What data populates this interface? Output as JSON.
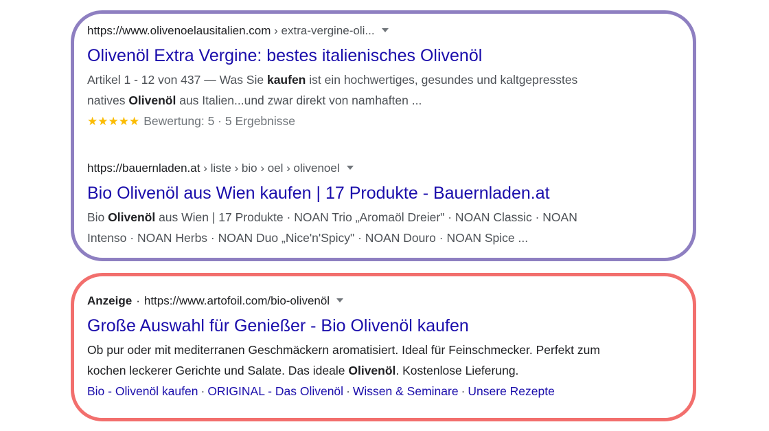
{
  "results": [
    {
      "url_domain": "https://www.olivenoelausitalien.com",
      "url_path": " › extra-vergine-oli...",
      "title": "Olivenöl Extra Vergine: bestes italienisches Olivenöl",
      "snippet_line1": [
        "Artikel 1 - 12 von 437 — Was Sie ",
        "kaufen",
        " ist ein hochwertiges, gesundes und kaltgepresstes"
      ],
      "snippet_line2": [
        "natives ",
        "Olivenöl",
        " aus Italien...und zwar direkt von namhaften ..."
      ],
      "stars": "★★★★★",
      "rating_text": "Bewertung: 5 · 5 Ergebnisse",
      "rating_value": 5
    },
    {
      "url_domain": "https://bauernladen.at",
      "url_path": " › liste › bio › oel › olivenoel",
      "title": "Bio Olivenöl aus Wien kaufen | 17 Produkte - Bauernladen.at",
      "snippet_line1": [
        "Bio ",
        "Olivenöl",
        " aus Wien | 17 Produkte · NOAN Trio „Aromaöl Dreier\" · NOAN Classic · NOAN"
      ],
      "snippet_line2": [
        "Intenso · NOAN Herbs · NOAN Duo „Nice'n'Spicy\" · NOAN Douro · NOAN Spice ..."
      ]
    }
  ],
  "ad": {
    "label": "Anzeige",
    "dot": "·",
    "url": "https://www.artofoil.com/bio-olivenöl",
    "title": "Große Auswahl für Genießer - Bio Olivenöl kaufen",
    "snippet_line1": [
      "Ob pur oder mit mediterranen Geschmäckern aromatisiert. Ideal für Feinschmecker. Perfekt zum"
    ],
    "snippet_line2": [
      "kochen leckerer Gerichte und Salate. Das ideale ",
      "Olivenöl",
      ". Kostenlose Lieferung."
    ],
    "sitelinks": [
      "Bio - Olivenöl kaufen",
      "ORIGINAL - Das Olivenöl",
      "Wissen & Seminare",
      "Unsere Rezepte"
    ],
    "sitelink_sep": "·"
  },
  "colors": {
    "organic_frame": "#8e7fc1",
    "ad_frame": "#f26f6d",
    "link_title": "#1a0dab",
    "star": "#fbbc04"
  }
}
